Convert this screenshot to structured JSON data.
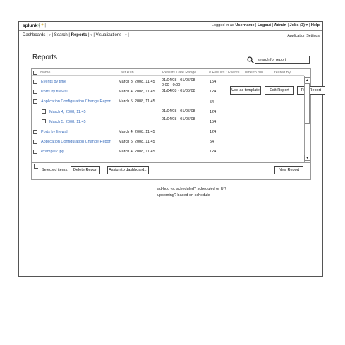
{
  "header": {
    "logo": "splunk",
    "logo_arrow": ">",
    "app_toggle_plus": "+",
    "user_prefix": "Logged in as",
    "username": "Username",
    "logout": "Logout",
    "admin": "Admin",
    "jobs": "Jobs (3)",
    "help": "Help"
  },
  "nav": {
    "items": [
      {
        "label": "Dashboards"
      },
      {
        "label": "Search"
      },
      {
        "label": "Reports"
      },
      {
        "label": "Visualizations"
      }
    ],
    "app_settings": "Application Settings"
  },
  "page": {
    "title": "Reports",
    "search_placeholder": "search for report"
  },
  "table": {
    "columns": [
      "Name",
      "Last Run",
      "Results Date Range",
      "# Results / Events",
      "Time to run",
      "Created By"
    ],
    "rows": [
      {
        "name": "Events by time",
        "last_run": "March 3, 2008, 11:45",
        "range1": "01/04/08 - 01/05/08",
        "range2": "0:00 - 0:00",
        "results": "154"
      },
      {
        "name": "Ports by firewall",
        "last_run": "March 4, 2008, 11:45",
        "range1": "01/04/08 - 01/05/08",
        "range2": "",
        "results": "124"
      },
      {
        "name": "Application Configuration Change Report",
        "last_run": "March 5, 2008, 11:45",
        "range1": "",
        "range2": "",
        "results": "54"
      },
      {
        "name": "March 4, 2008, 11:45",
        "last_run": "",
        "range1": "01/04/08 - 01/05/08",
        "range2": "",
        "results": "124"
      },
      {
        "name": "March 5, 2008, 11:45",
        "last_run": "",
        "range1": "01/04/08 - 01/05/08",
        "range2": "",
        "results": "154"
      },
      {
        "name": "Ports by firewall",
        "last_run": "March 4, 2008, 11:45",
        "range1": "",
        "range2": "",
        "results": "124"
      },
      {
        "name": "Application Configuration Change Report",
        "last_run": "March 5, 2008, 11:45",
        "range1": "",
        "range2": "",
        "results": "54"
      },
      {
        "name": "example2.jpg",
        "last_run": "March 4, 2008, 11:45",
        "range1": "",
        "range2": "",
        "results": "124"
      }
    ],
    "row_actions": {
      "use_as_template": "Use as template",
      "edit_report": "Edit Report",
      "run_report": "Run Report"
    }
  },
  "footer": {
    "selected_items": "Selected items:",
    "delete_report": "Delete Report",
    "assign_dashboard": "Assign to dashboard...",
    "new_report": "New Report"
  },
  "notes": [
    "ad-hoc vs. scheduled? scheduled or UI?",
    "upcoming? based on schedule"
  ],
  "colors": {
    "link": "#3c6fbd",
    "border": "#555555"
  }
}
